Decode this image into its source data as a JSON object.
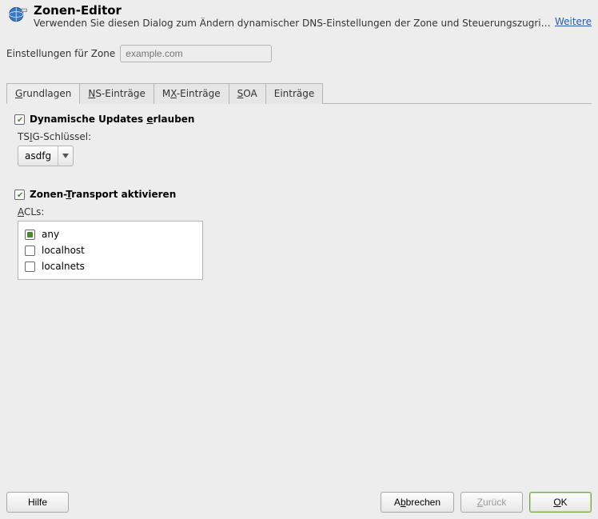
{
  "header": {
    "title": "Zonen-Editor",
    "description": "Verwenden Sie diesen Dialog zum Ändern dynamischer DNS-Einstellungen der Zone und Steuerungszugriff au...",
    "more": "Weitere"
  },
  "zone": {
    "label": "Einstellungen für Zone",
    "placeholder": "example.com",
    "value": ""
  },
  "tabs": {
    "items": [
      {
        "pre": "",
        "u": "G",
        "post": "rundlagen",
        "active": true
      },
      {
        "pre": "",
        "u": "N",
        "post": "S-Einträge",
        "active": false
      },
      {
        "pre": "M",
        "u": "X",
        "post": "-Einträge",
        "active": false
      },
      {
        "pre": "",
        "u": "S",
        "post": "OA",
        "active": false
      },
      {
        "pre": "Einträge",
        "u": "",
        "post": "",
        "active": false
      }
    ]
  },
  "dyn": {
    "checked": true,
    "lbl_pre": "Dynamische Updates ",
    "lbl_u": "e",
    "lbl_post": "rlauben",
    "tsig_pre": "TS",
    "tsig_u": "I",
    "tsig_post": "G-Schlüssel:",
    "tsig_selected": "asdfg"
  },
  "zt": {
    "checked": true,
    "lbl_pre": "Zonen-",
    "lbl_u": "T",
    "lbl_post": "ransport aktivieren",
    "acls_u": "A",
    "acls_post": "CLs:",
    "items": [
      {
        "label": "any",
        "checked": true
      },
      {
        "label": "localhost",
        "checked": false
      },
      {
        "label": "localnets",
        "checked": false
      }
    ]
  },
  "footer": {
    "help": "Hilfe",
    "cancel_pre": "A",
    "cancel_u": "b",
    "cancel_post": "brechen",
    "back_u": "Z",
    "back_post": "urück",
    "ok_u": "O",
    "ok_post": "K"
  }
}
